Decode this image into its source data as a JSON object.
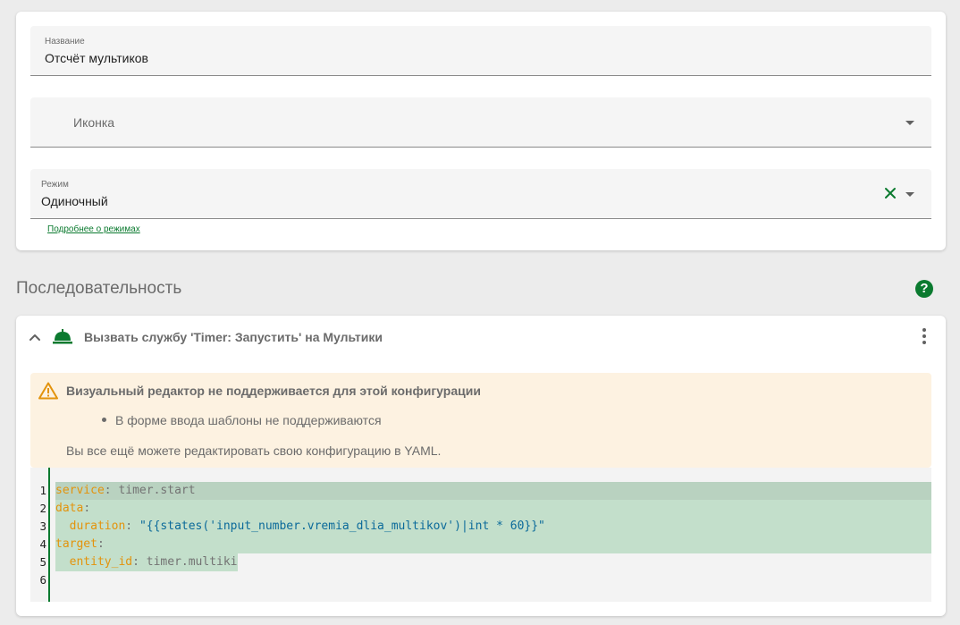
{
  "form": {
    "name_label": "Название",
    "name_value": "Отсчёт мультиков",
    "icon_placeholder": "Иконка",
    "mode_label": "Режим",
    "mode_value": "Одиночный",
    "modes_link": "Подробнее о режимах"
  },
  "sequence": {
    "title": "Последовательность",
    "help_icon": "?",
    "action": {
      "title": "Вызвать службу 'Timer: Запустить' на Мультики"
    }
  },
  "warning": {
    "title": "Визуальный редактор не поддерживается для этой конфигурации",
    "items": [
      "В форме ввода шаблоны не поддерживаются"
    ],
    "footer": "Вы все ещё можете редактировать свою конфигурацию в YAML."
  },
  "yaml": {
    "line_numbers": [
      "1",
      "2",
      "3",
      "4",
      "5",
      "6"
    ],
    "l1_key": "service",
    "l1_colon": ": ",
    "l1_value": "timer.start",
    "l2_key": "data",
    "l2_colon": ":",
    "l3_indent": "  ",
    "l3_key": "duration",
    "l3_colon": ": ",
    "l3_value": "\"{{states('input_number.vremia_dlia_multikov')|int * 60}}\"",
    "l4_key": "target",
    "l4_colon": ":",
    "l5_indent": "  ",
    "l5_key": "entity_id",
    "l5_colon": ": ",
    "l5_value": "timer.multiki"
  },
  "colors": {
    "accent": "#0b7a2f",
    "warning_bg": "#fdf2e1",
    "warning_icon": "#e3930c",
    "yaml_key": "#e3930c",
    "yaml_string": "#0b6a9a",
    "selection": "#c3dfcb"
  }
}
